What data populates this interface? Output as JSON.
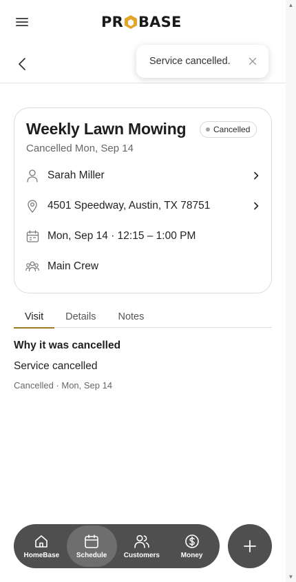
{
  "header": {
    "logo_left": "PR",
    "logo_right": "BASE"
  },
  "toast": {
    "message": "Service cancelled."
  },
  "card": {
    "title": "Weekly Lawn Mowing",
    "status": "Cancelled",
    "subtitle": "Cancelled Mon, Sep 14",
    "customer": "Sarah Miller",
    "address": "4501 Speedway, Austin, TX 78751",
    "schedule": "Mon, Sep 14 · 12:15 – 1:00 PM",
    "crew": "Main Crew"
  },
  "tabs": [
    {
      "label": "Visit",
      "active": true
    },
    {
      "label": "Details",
      "active": false
    },
    {
      "label": "Notes",
      "active": false
    }
  ],
  "visit": {
    "section_title": "Why it was cancelled",
    "reason": "Service cancelled",
    "meta": "Cancelled · Mon, Sep 14"
  },
  "nav": {
    "items": [
      {
        "label": "HomeBase",
        "icon": "home-icon"
      },
      {
        "label": "Schedule",
        "icon": "calendar-icon",
        "active": true
      },
      {
        "label": "Customers",
        "icon": "users-icon"
      },
      {
        "label": "Money",
        "icon": "dollar-icon"
      }
    ]
  },
  "colors": {
    "accent": "#9a7a1a",
    "logo_mark": "#e3a52a",
    "nav_bg": "#4f4f4f",
    "nav_active": "#6e6e6e"
  }
}
